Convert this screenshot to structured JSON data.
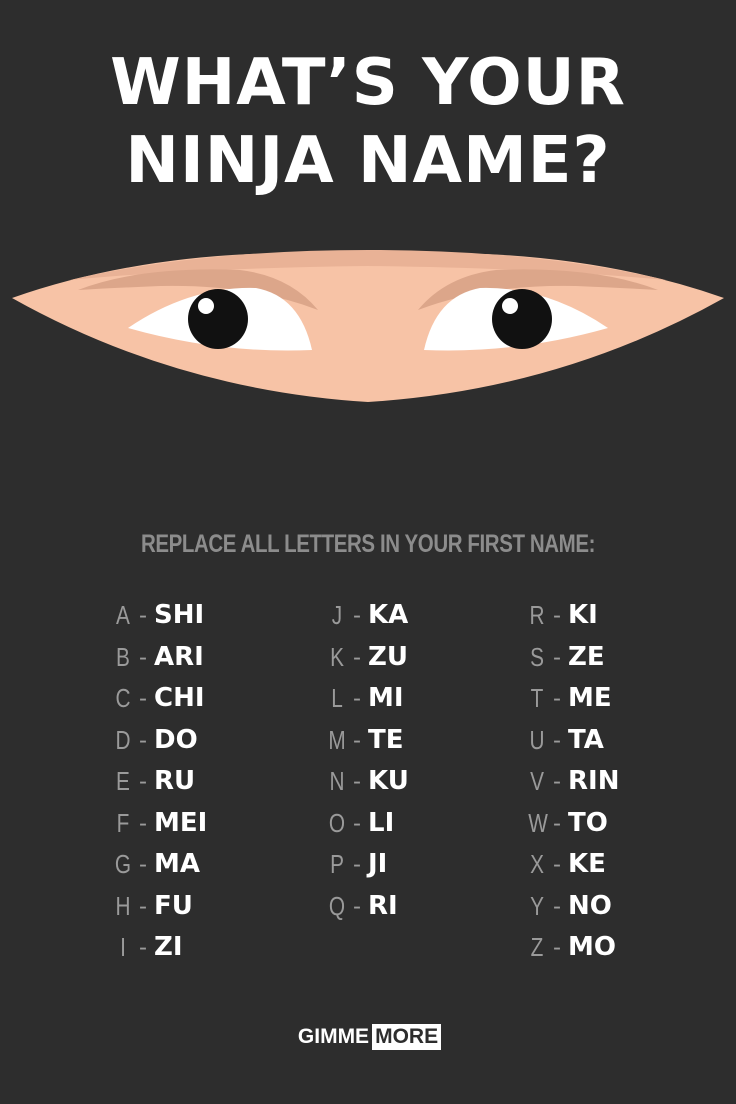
{
  "title": {
    "line1": "WHAT’S YOUR",
    "line2": "NINJA NAME?"
  },
  "subtitle": "REPLACE ALL LETTERS IN YOUR FIRST NAME:",
  "columns": [
    [
      {
        "letter": "A",
        "name": "SHI"
      },
      {
        "letter": "B",
        "name": "ARI"
      },
      {
        "letter": "C",
        "name": "CHI"
      },
      {
        "letter": "D",
        "name": "DO"
      },
      {
        "letter": "E",
        "name": "RU"
      },
      {
        "letter": "F",
        "name": "MEI"
      },
      {
        "letter": "G",
        "name": "MA"
      },
      {
        "letter": "H",
        "name": "FU"
      },
      {
        "letter": "I",
        "name": "ZI"
      }
    ],
    [
      {
        "letter": "J",
        "name": "KA"
      },
      {
        "letter": "K",
        "name": "ZU"
      },
      {
        "letter": "L",
        "name": "MI"
      },
      {
        "letter": "M",
        "name": "TE"
      },
      {
        "letter": "N",
        "name": "KU"
      },
      {
        "letter": "O",
        "name": "LI"
      },
      {
        "letter": "P",
        "name": "JI"
      },
      {
        "letter": "Q",
        "name": "RI"
      }
    ],
    [
      {
        "letter": "R",
        "name": "KI"
      },
      {
        "letter": "S",
        "name": "ZE"
      },
      {
        "letter": "T",
        "name": "ME"
      },
      {
        "letter": "U",
        "name": "TA"
      },
      {
        "letter": "V",
        "name": "RIN"
      },
      {
        "letter": "W",
        "name": "TO"
      },
      {
        "letter": "X",
        "name": "KE"
      },
      {
        "letter": "Y",
        "name": "NO"
      },
      {
        "letter": "Z",
        "name": "MO"
      }
    ]
  ],
  "dash": "-",
  "logo": {
    "part1": "GIMME",
    "part2": "MORE"
  },
  "colors": {
    "background": "#2d2d2d",
    "skin": "#f7c3a6",
    "skin_shadow": "#dca68a",
    "muted_text": "#9a9a9a"
  }
}
